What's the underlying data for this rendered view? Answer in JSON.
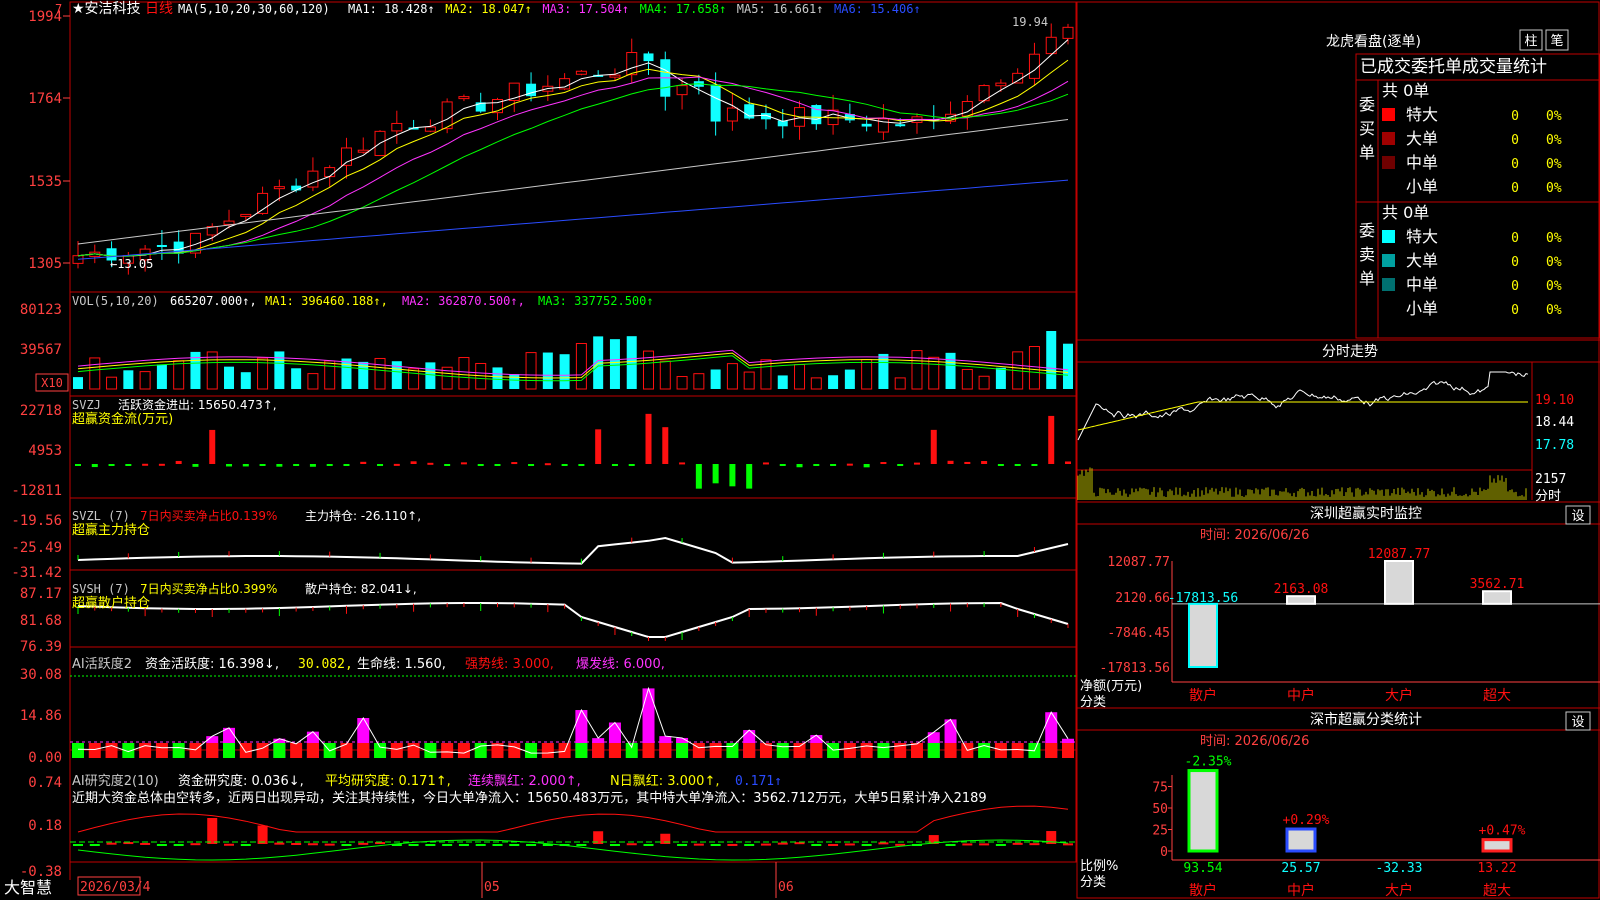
{
  "colors": {
    "up": "#ff1010",
    "down": "#10ffff",
    "frame": "#c00000",
    "white": "#ffffff",
    "yellow": "#ffff00",
    "magenta": "#ff33ff",
    "green": "#00ff00",
    "blue": "#2a4cff",
    "grey": "#c8c8c8",
    "axis": "#ff4040"
  },
  "main": {
    "stock_name": "安洁科技",
    "period": "日线",
    "ma_label": "MA(5,10,20,30,60,120)",
    "ma": [
      {
        "label": "MA1: 18.428",
        "color": "#ffffff"
      },
      {
        "label": "MA2: 18.047",
        "color": "#ffff00"
      },
      {
        "label": "MA3: 17.504",
        "color": "#ff33ff"
      },
      {
        "label": "MA4: 17.658",
        "color": "#00ff00"
      },
      {
        "label": "MA5: 16.661",
        "color": "#c8c8c8"
      },
      {
        "label": "MA6: 15.406",
        "color": "#2a4cff"
      }
    ],
    "y_ticks": [
      "1994",
      "1764",
      "1535",
      "1305"
    ],
    "corner_digit": "7",
    "high_label": "19.94",
    "low_label": "13.05",
    "date_start": "2026/03/4",
    "month_labels": [
      "05",
      "06"
    ],
    "brand": "大智慧"
  },
  "vol": {
    "title": "VOL(5,10,20)",
    "value": "665207.000",
    "ma1": "MA1: 396460.188",
    "ma2": "MA2: 362870.500",
    "ma3": "MA3: 337752.500",
    "y_ticks": [
      "80123",
      "39567"
    ],
    "unit": "X10"
  },
  "svzj": {
    "title": "SVZJ",
    "desc": "活跃资金进出:",
    "value": "15650.473",
    "sub": "超赢资金流(万元)",
    "y_ticks": [
      "22718",
      "4953",
      "-12811"
    ]
  },
  "svzl": {
    "title": "SVZL (7)",
    "desc": "7日内买卖净占比0.139%",
    "desc2": "主力持仓:",
    "value": "-26.110",
    "sub": "超赢主力持仓",
    "y_ticks": [
      "-19.56",
      "-25.49",
      "-31.42"
    ]
  },
  "svsh": {
    "title": "SVSH (7)",
    "desc": "7日内买卖净占比0.399%",
    "desc2": "散户持仓:",
    "value": "82.041",
    "sub": "超赢散户持仓",
    "y_ticks": [
      "87.17",
      "81.68",
      "76.39"
    ]
  },
  "ai1": {
    "title": "AI活跃度2",
    "desc": "资金活跃度:",
    "value": "16.398",
    "v2": "30.082,",
    "v3": "生命线: 1.560,",
    "v4": "强势线: 3.000,",
    "v5": "爆发线: 6.000,",
    "y_ticks": [
      "30.08",
      "14.86",
      "0.00"
    ]
  },
  "ai2": {
    "title": "AI研究度2(10)",
    "desc": "资金研究度:",
    "value": "0.036",
    "v2": "平均研究度: 0.171",
    "v3": "连续飘红: 2.000",
    "v4": "N日飘红: 3.000",
    "v5": "0.171",
    "comment": "近期大资金总体由空转多，近两日出现异动，关注其持续性，今日大单净流入：15650.483万元，其中特大单净流入：3562.712万元，大单5日累计净入2189",
    "y_ticks": [
      "0.74",
      "0.18",
      "-0.38"
    ]
  },
  "dragon": {
    "title": "龙虎看盘(逐单)",
    "btn1": "柱",
    "btn2": "笔",
    "subtitle": "已成交委托单成交量统计",
    "buy_label": "委买单",
    "sell_label": "委卖单",
    "buy_total": "共 0单",
    "sell_total": "共 0单",
    "buy_rows": [
      {
        "name": "特大",
        "v": "0",
        "p": "0%",
        "c": "#ff0000"
      },
      {
        "name": "大单",
        "v": "0",
        "p": "0%",
        "c": "#a00000"
      },
      {
        "name": "中单",
        "v": "0",
        "p": "0%",
        "c": "#700000"
      },
      {
        "name": "小单",
        "v": "0",
        "p": "0%",
        "c": "#000000"
      }
    ],
    "sell_rows": [
      {
        "name": "特大",
        "v": "0",
        "p": "0%",
        "c": "#00ffff"
      },
      {
        "name": "大单",
        "v": "0",
        "p": "0%",
        "c": "#00a0a0"
      },
      {
        "name": "中单",
        "v": "0",
        "p": "0%",
        "c": "#007070"
      },
      {
        "name": "小单",
        "v": "0",
        "p": "0%",
        "c": "#000000"
      }
    ]
  },
  "intraday": {
    "title": "分时走势",
    "y_ticks": [
      "19.10",
      "18.44",
      "17.78"
    ],
    "vol_label": "2157",
    "time_label": "分时"
  },
  "sz_monitor": {
    "title": "深圳超赢实时监控",
    "set": "设",
    "time": "时间: 2026/06/26",
    "y_ticks": [
      "12087.77",
      "2120.66",
      "-7846.45",
      "-17813.56"
    ],
    "bars": [
      {
        "cat": "散户",
        "value": -17813.56,
        "label": "-17813.56"
      },
      {
        "cat": "中户",
        "value": 2163.08,
        "label": "2163.08"
      },
      {
        "cat": "大户",
        "value": 12087.77,
        "label": "12087.77"
      },
      {
        "cat": "超大",
        "value": 3562.71,
        "label": "3562.71"
      }
    ],
    "axis_title1": "净额(万元)",
    "axis_title2": "分类"
  },
  "sz_class": {
    "title": "深市超赢分类统计",
    "set": "设",
    "time": "时间: 2026/06/26",
    "y_ticks": [
      "75",
      "50",
      "25",
      "0"
    ],
    "bars": [
      {
        "cat": "散户",
        "pct": "-2.35%",
        "value": 93.54,
        "label": "93.54"
      },
      {
        "cat": "中户",
        "pct": "+0.29%",
        "value": 25.57,
        "label": "25.57"
      },
      {
        "cat": "大户",
        "pct": "",
        "value": -32.33,
        "label": "-32.33"
      },
      {
        "cat": "超大",
        "pct": "+0.47%",
        "value": 13.22,
        "label": "13.22"
      }
    ],
    "axis_title1": "比例%",
    "axis_title2": "分类"
  },
  "chart_data": {
    "type": "bar",
    "title": "深圳超赢实时监控",
    "categories": [
      "散户",
      "中户",
      "大户",
      "超大"
    ],
    "values": [
      -17813.56,
      2163.08,
      12087.77,
      3562.71
    ],
    "ylabel": "净额(万元)",
    "ylim": [
      -17813.56,
      12087.77
    ]
  }
}
